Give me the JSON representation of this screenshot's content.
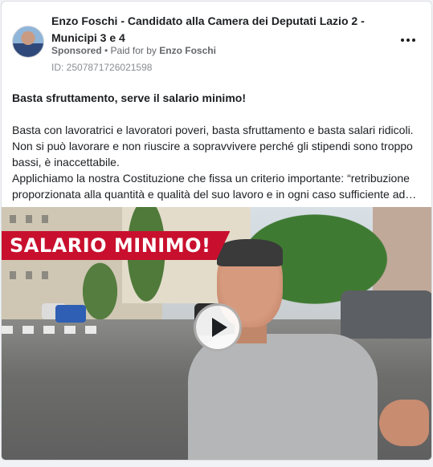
{
  "post": {
    "page_name": "Enzo Foschi - Candidato alla Camera dei Deputati Lazio 2 - Municipi 3 e 4",
    "sponsored_label": "Sponsored",
    "separator": " • ",
    "paid_for_prefix": "Paid for by ",
    "payer": "Enzo Foschi",
    "ad_id": "ID: 2507871726021598",
    "headline": "Basta sfruttamento, serve il salario minimo!",
    "body": [
      "Basta con lavoratrici e lavoratori poveri, basta sfruttamento e basta salari ridicoli. Non si può lavorare e non riuscire a sopravvivere perché gli stipendi sono troppo bassi, è inaccettabile.",
      "Applichiamo la nostra Costituzione che fissa un criterio importante: “retribuzione proporzionata alla quantità e qualità del suo lavoro e in ogni caso sufficiente ad…"
    ]
  },
  "media": {
    "banner_text": "SALARIO MINIMO!",
    "play_icon": "play-icon"
  },
  "icons": {
    "more": "more-options-icon",
    "avatar": "avatar"
  },
  "colors": {
    "banner_red": "#c8102e",
    "meta_grey": "#65676b"
  }
}
